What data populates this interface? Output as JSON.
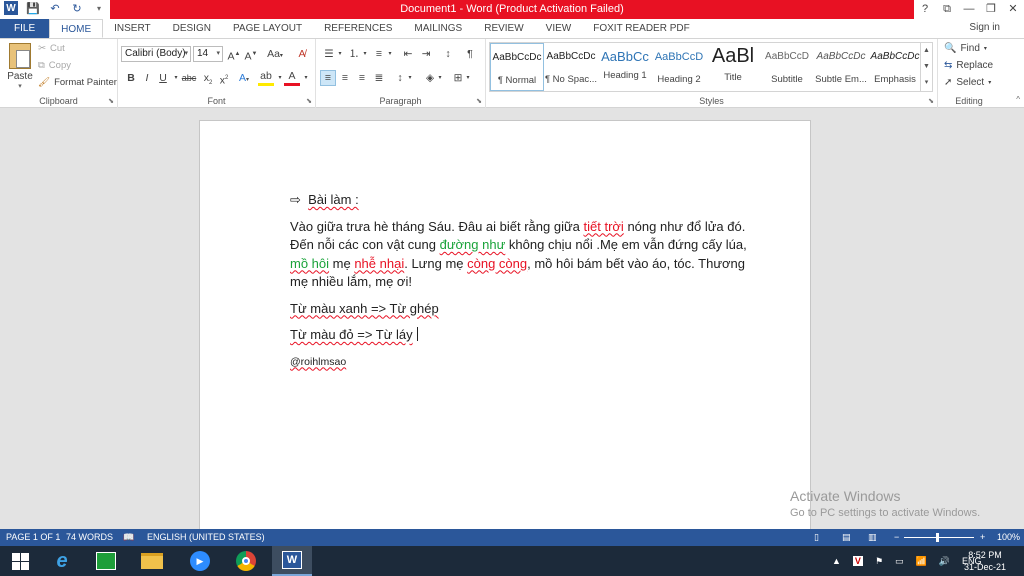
{
  "titlebar": {
    "title": "Document1 - Word (Product Activation Failed)",
    "help": "?",
    "ribbon_options": "⧉",
    "minimize": "—",
    "restore": "❐",
    "close": "✕"
  },
  "tabs": {
    "file": "FILE",
    "items": [
      "HOME",
      "INSERT",
      "DESIGN",
      "PAGE LAYOUT",
      "REFERENCES",
      "MAILINGS",
      "REVIEW",
      "VIEW",
      "FOXIT READER PDF"
    ],
    "active": "HOME",
    "signin": "Sign in"
  },
  "clipboard": {
    "paste": "Paste",
    "cut": "Cut",
    "copy": "Copy",
    "format_painter": "Format Painter",
    "label": "Clipboard"
  },
  "font": {
    "family": "Calibri (Body)",
    "size": "14",
    "label": "Font"
  },
  "paragraph": {
    "label": "Paragraph"
  },
  "styles": {
    "label": "Styles",
    "items": [
      {
        "sample": "AaBbCcDc",
        "name": "¶ Normal"
      },
      {
        "sample": "AaBbCcDc",
        "name": "¶ No Spac..."
      },
      {
        "sample": "AaBbCc",
        "name": "Heading 1"
      },
      {
        "sample": "AaBbCcD",
        "name": "Heading 2"
      },
      {
        "sample": "AaBl",
        "name": "Title"
      },
      {
        "sample": "AaBbCcD",
        "name": "Subtitle"
      },
      {
        "sample": "AaBbCcDc",
        "name": "Subtle Em..."
      },
      {
        "sample": "AaBbCcDc",
        "name": "Emphasis"
      }
    ]
  },
  "editing": {
    "find": "Find",
    "replace": "Replace",
    "select": "Select",
    "label": "Editing"
  },
  "document": {
    "heading_arrow": "⇨",
    "heading": "Bài làm :",
    "p1": {
      "a": "Vào giữa trưa hè tháng Sáu. Đâu ai biết rằng giữa ",
      "b": "tiết trời",
      "c": " nóng như đổ lửa đó. Đến nỗi các con vật cung ",
      "d": "đường như",
      "e": " không chịu nổi .Mẹ em vẫn đứng cấy lúa, ",
      "f": "mồ hôi",
      "g": " mẹ ",
      "h": "nhễ nhại",
      "i": ". Lưng mẹ ",
      "j": "còng còng",
      "k": ", mồ hôi bám bết vào áo, tóc. Thương mẹ nhiều lắm, mẹ ơi!"
    },
    "line2": "Từ màu xanh => Từ ghép",
    "line3": "Từ màu đỏ => Từ láy",
    "credit": "@roihlmsao"
  },
  "watermark": {
    "line1": "Activate Windows",
    "line2": "Go to PC settings to activate Windows."
  },
  "status": {
    "page": "PAGE 1 OF 1",
    "words": "74 WORDS",
    "language": "ENGLISH (UNITED STATES)",
    "zoom": "100%"
  },
  "taskbar": {
    "lang": "ENG",
    "time": "8:52 PM",
    "date": "31-Dec-21"
  }
}
